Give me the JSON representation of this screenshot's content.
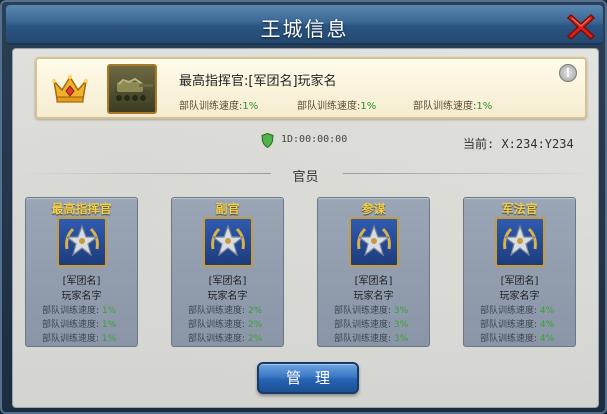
{
  "window": {
    "title": "王城信息"
  },
  "commander": {
    "name": "最高指挥官:[军团名]玩家名",
    "stats": [
      {
        "label": "部队训练速度:",
        "value": "1%"
      },
      {
        "label": "部队训练速度:",
        "value": "1%"
      },
      {
        "label": "部队训练速度:",
        "value": "1%"
      }
    ]
  },
  "status": {
    "timer": "1D:00:00:00",
    "coords": "当前: X:234:Y234"
  },
  "officers_section": {
    "title": "官员"
  },
  "officers": [
    {
      "title": "最高指挥官",
      "legion": "[军团名]",
      "player": "玩家名字",
      "stats": [
        {
          "label": "部队训练速度:",
          "value": "1%"
        },
        {
          "label": "部队训练速度:",
          "value": "1%"
        },
        {
          "label": "部队训练速度:",
          "value": "1%"
        }
      ]
    },
    {
      "title": "副官",
      "legion": "[军团名]",
      "player": "玩家名字",
      "stats": [
        {
          "label": "部队训练速度:",
          "value": "2%"
        },
        {
          "label": "部队训练速度:",
          "value": "2%"
        },
        {
          "label": "部队训练速度:",
          "value": "2%"
        }
      ]
    },
    {
      "title": "参谋",
      "legion": "[军团名]",
      "player": "玩家名字",
      "stats": [
        {
          "label": "部队训练速度:",
          "value": "3%"
        },
        {
          "label": "部队训练速度:",
          "value": "3%"
        },
        {
          "label": "部队训练速度:",
          "value": "3%"
        }
      ]
    },
    {
      "title": "军法官",
      "legion": "[军团名]",
      "player": "玩家名字",
      "stats": [
        {
          "label": "部队训练速度:",
          "value": "4%"
        },
        {
          "label": "部队训练速度:",
          "value": "4%"
        },
        {
          "label": "部队训练速度:",
          "value": "4%"
        }
      ]
    }
  ],
  "buttons": {
    "manage": "管理"
  },
  "icons": {
    "close": "close-icon",
    "crown": "crown-icon",
    "commander_portrait": "tank-portrait-icon",
    "info": "info-icon",
    "shield": "shield-icon",
    "officer_emblem": "star-wreath-emblem-icon"
  },
  "colors": {
    "accent_gold": "#f3d04b",
    "stat_green": "#39a232",
    "button_blue": "#2663b3",
    "close_red": "#d9221b"
  }
}
